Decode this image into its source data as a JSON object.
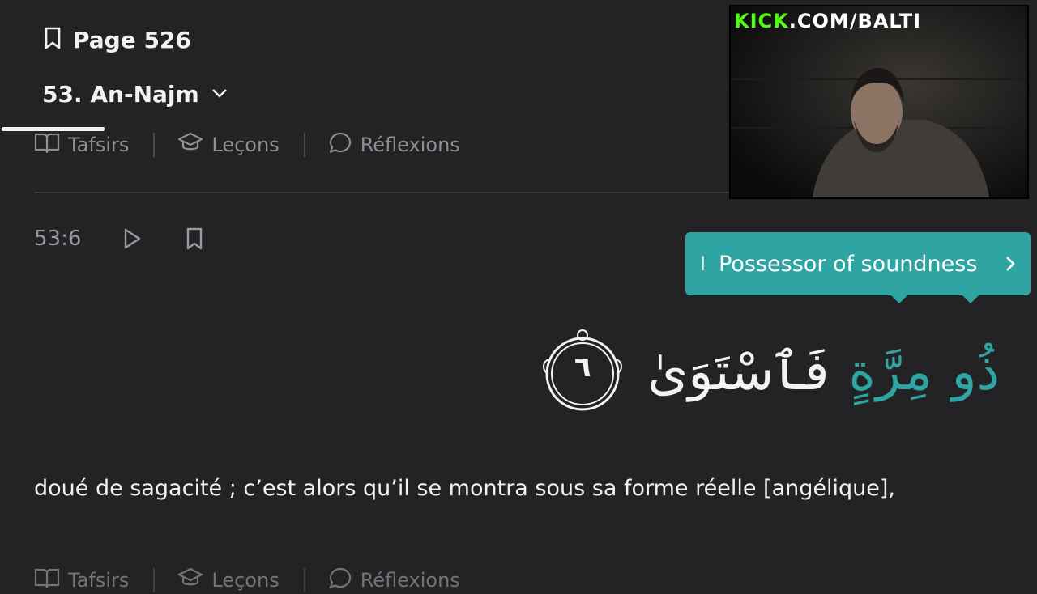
{
  "header": {
    "page_label": "Page 526",
    "surah_label": "53. An-Najm"
  },
  "tabs": [
    {
      "label": "Tafsirs",
      "icon": "book-icon"
    },
    {
      "label": "Leçons",
      "icon": "graduation-cap-icon"
    },
    {
      "label": "Réflexions",
      "icon": "chat-bubble-icon"
    }
  ],
  "verse": {
    "key": "53:6",
    "arabic_words": [
      "ذُو",
      "مِرَّةٍ",
      "فَٱسْتَوَىٰ"
    ],
    "ayah_number": "٦",
    "translation": "doué de sagacité ; c’est alors qu’il se montra sous sa forme réelle [angélique],"
  },
  "tooltip": {
    "text": "Possessor of soundness",
    "clipped_prefix": "I"
  },
  "bottom_tabs": [
    {
      "label": "Tafsirs"
    },
    {
      "label": "Leçons"
    },
    {
      "label": "Réflexions"
    }
  ],
  "overlay": {
    "brand_kick": "KICK",
    "brand_domain": ".COM/BALTI"
  },
  "colors": {
    "background": "#232325",
    "accent": "#2fa5a3",
    "text": "#f2f2f2",
    "muted": "#8f8f94",
    "brand_green": "#53fc18"
  }
}
